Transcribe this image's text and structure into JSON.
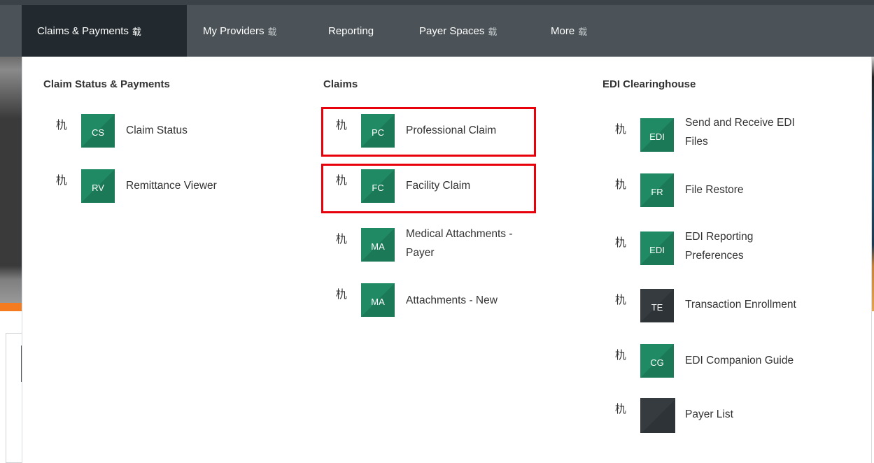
{
  "nav": {
    "items": [
      {
        "label": "Claims & Payments",
        "chevron": "载",
        "active": true
      },
      {
        "label": "My Providers",
        "chevron": "载"
      },
      {
        "label": "Reporting"
      },
      {
        "label": "Payer Spaces",
        "chevron": "载"
      },
      {
        "label": "More",
        "chevron": "载"
      }
    ]
  },
  "menu": {
    "pin_glyph": "朹",
    "columns": [
      {
        "title": "Claim Status & Payments",
        "items": [
          {
            "tile": "CS",
            "label": "Claim Status"
          },
          {
            "tile": "RV",
            "label": "Remittance Viewer"
          }
        ]
      },
      {
        "title": "Claims",
        "items": [
          {
            "tile": "PC",
            "label": "Professional Claim",
            "highlighted": true
          },
          {
            "tile": "FC",
            "label": "Facility Claim",
            "highlighted": true
          },
          {
            "tile": "MA",
            "label_lines": [
              "Medical Attachments -",
              "Payer"
            ]
          },
          {
            "tile": "MA",
            "label": "Attachments - New"
          }
        ]
      },
      {
        "title": "EDI Clearinghouse",
        "items": [
          {
            "tile": "EDI",
            "label_lines": [
              "Send and Receive EDI",
              "Files"
            ]
          },
          {
            "tile": "FR",
            "label": "File Restore"
          },
          {
            "tile": "EDI",
            "label_lines": [
              "EDI Reporting",
              "Preferences"
            ]
          },
          {
            "tile": "TE",
            "label": "Transaction Enrollment",
            "tile_style": "dark"
          },
          {
            "tile": "CG",
            "label": "EDI Companion Guide"
          },
          {
            "tile": "",
            "label": "Payer List",
            "tile_style": "dark"
          }
        ]
      }
    ]
  },
  "colors": {
    "navbar": "#4b5358",
    "nav_active": "#222a2f",
    "tile_green": "#1f8a64",
    "tile_dark": "#353b3f",
    "highlight_red": "#e8000a"
  },
  "icons": {
    "nav_chevron": "chevron-down-icon",
    "pin": "pin-icon"
  }
}
